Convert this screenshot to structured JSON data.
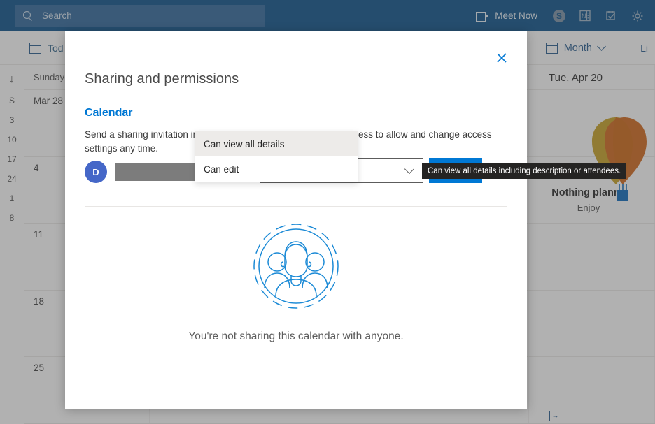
{
  "suite": {
    "search_placeholder": "Search",
    "meet_now_label": "Meet Now",
    "icons": {
      "search": "search-icon",
      "camera": "video-camera-icon",
      "skype": "skype-icon",
      "onenote": "onenote-icon",
      "tasks": "tasks-icon",
      "settings": "gear-icon"
    },
    "skype_glyph": "S",
    "accent_blue": "#0f548c"
  },
  "command_bar": {
    "today_label": "Tod",
    "view_label": "Month",
    "list_label": "Li"
  },
  "calendar": {
    "mini_week_numbers": [
      "S",
      "3",
      "10",
      "17",
      "24",
      "1",
      "8"
    ],
    "scroll_arrow": "↓",
    "day_headers": [
      "Sunday"
    ],
    "tuesday_header": "Tue, Apr 20",
    "week_cells": [
      "Mar 28",
      "4",
      "11",
      "18",
      "25"
    ],
    "nothing_planned_title": "Nothing planne",
    "nothing_planned_sub": "Enjoy",
    "add_calendar_icon": "add-calendar-icon"
  },
  "dialog": {
    "title": "Sharing and permissions",
    "close_icon": "close-icon",
    "calendar_name": "Calendar",
    "description": "Send a sharing invitation in email. You can choose how much access to allow and change access settings any time.",
    "avatar_initial": "D",
    "recipient_value": "",
    "permission_selected": "Can view all details",
    "permission_options": [
      {
        "label": "Can view all details",
        "selected": true
      },
      {
        "label": "Can edit",
        "selected": false
      }
    ],
    "share_button": "Share",
    "delete_icon": "trash-icon",
    "tooltip": "Can view all details including description or attendees.",
    "empty_state_text": "You're not sharing this calendar with anyone.",
    "empty_state_icon": "people-circle-illustration",
    "accent_blue": "#0078d4",
    "avatar_color": "#4567c8"
  }
}
